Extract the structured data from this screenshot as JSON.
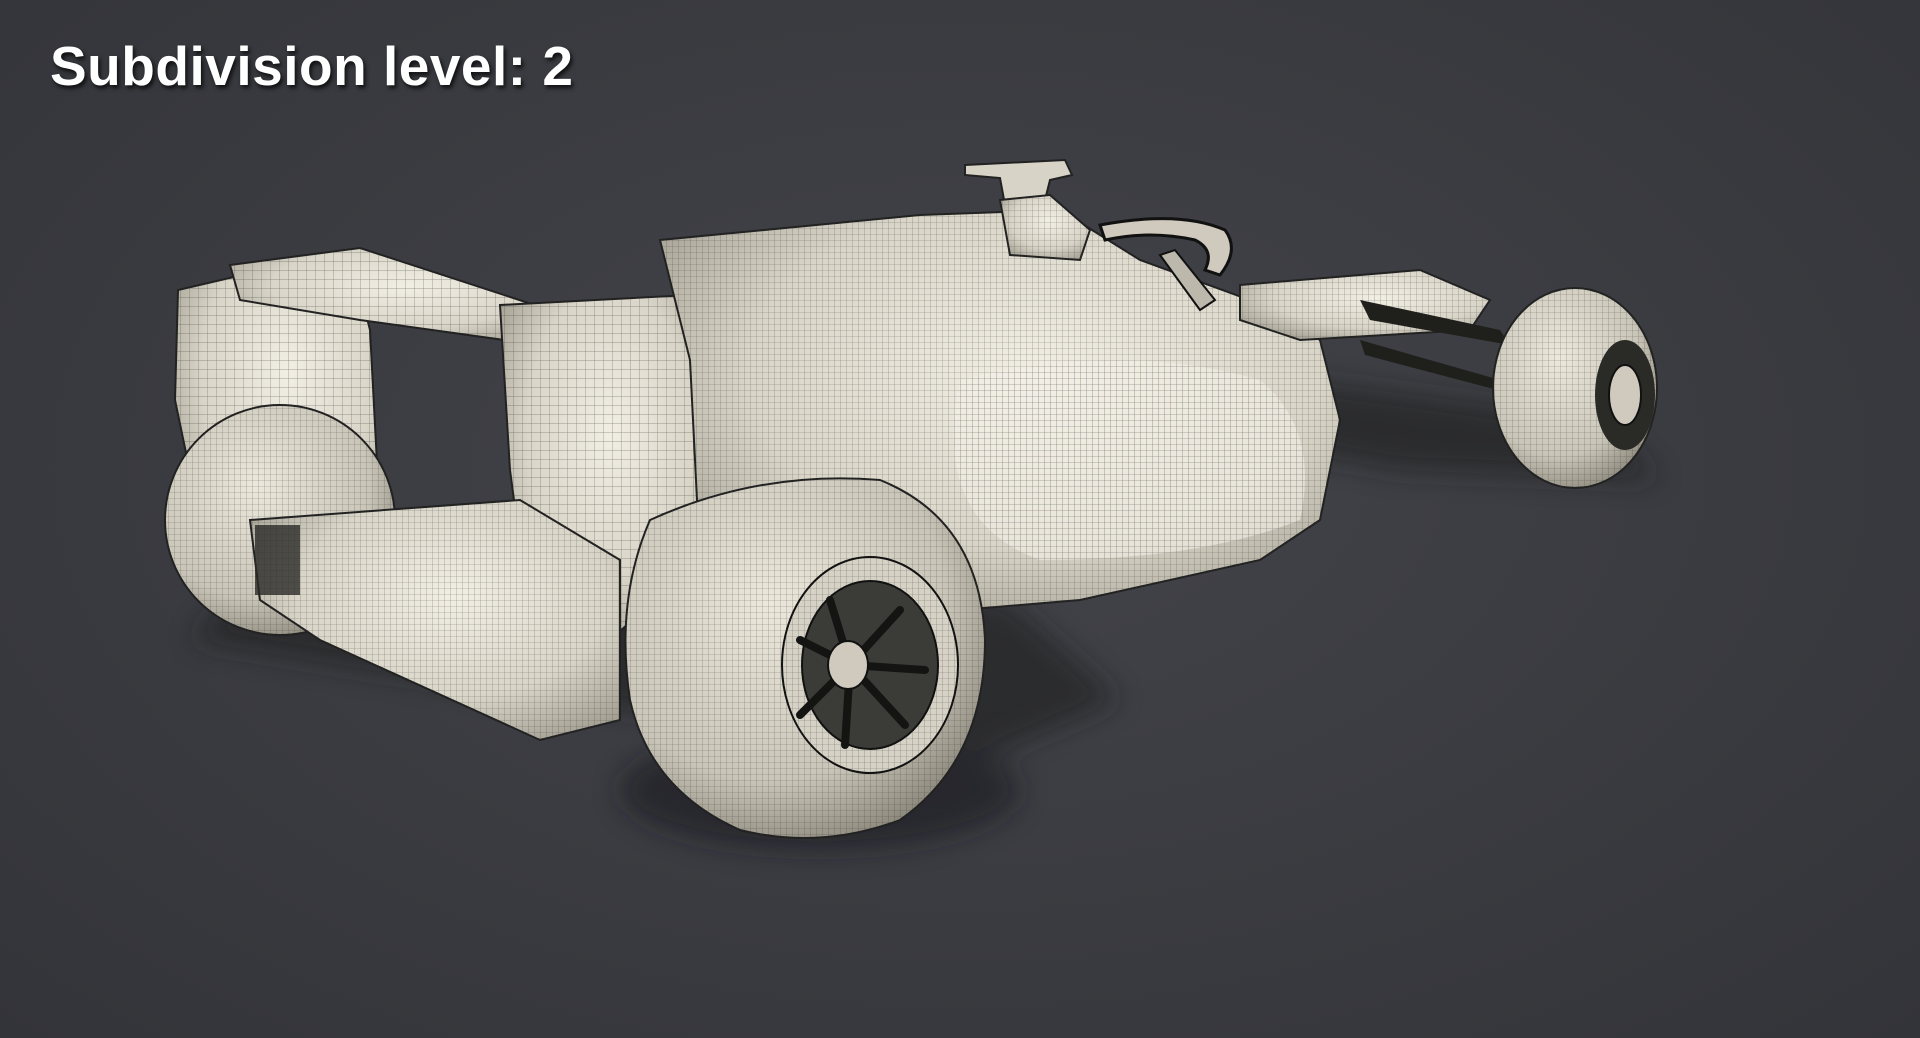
{
  "viewport": {
    "overlay_label": "Subdivision level: 2"
  },
  "scene": {
    "subject": "f1-car-wireframe-model",
    "colors": {
      "background": "#3a3b40",
      "surface": "#e7e3d6",
      "surface_shade": "#a9a596",
      "wire": "#2a2a26",
      "shadow": "#1f2024"
    }
  }
}
